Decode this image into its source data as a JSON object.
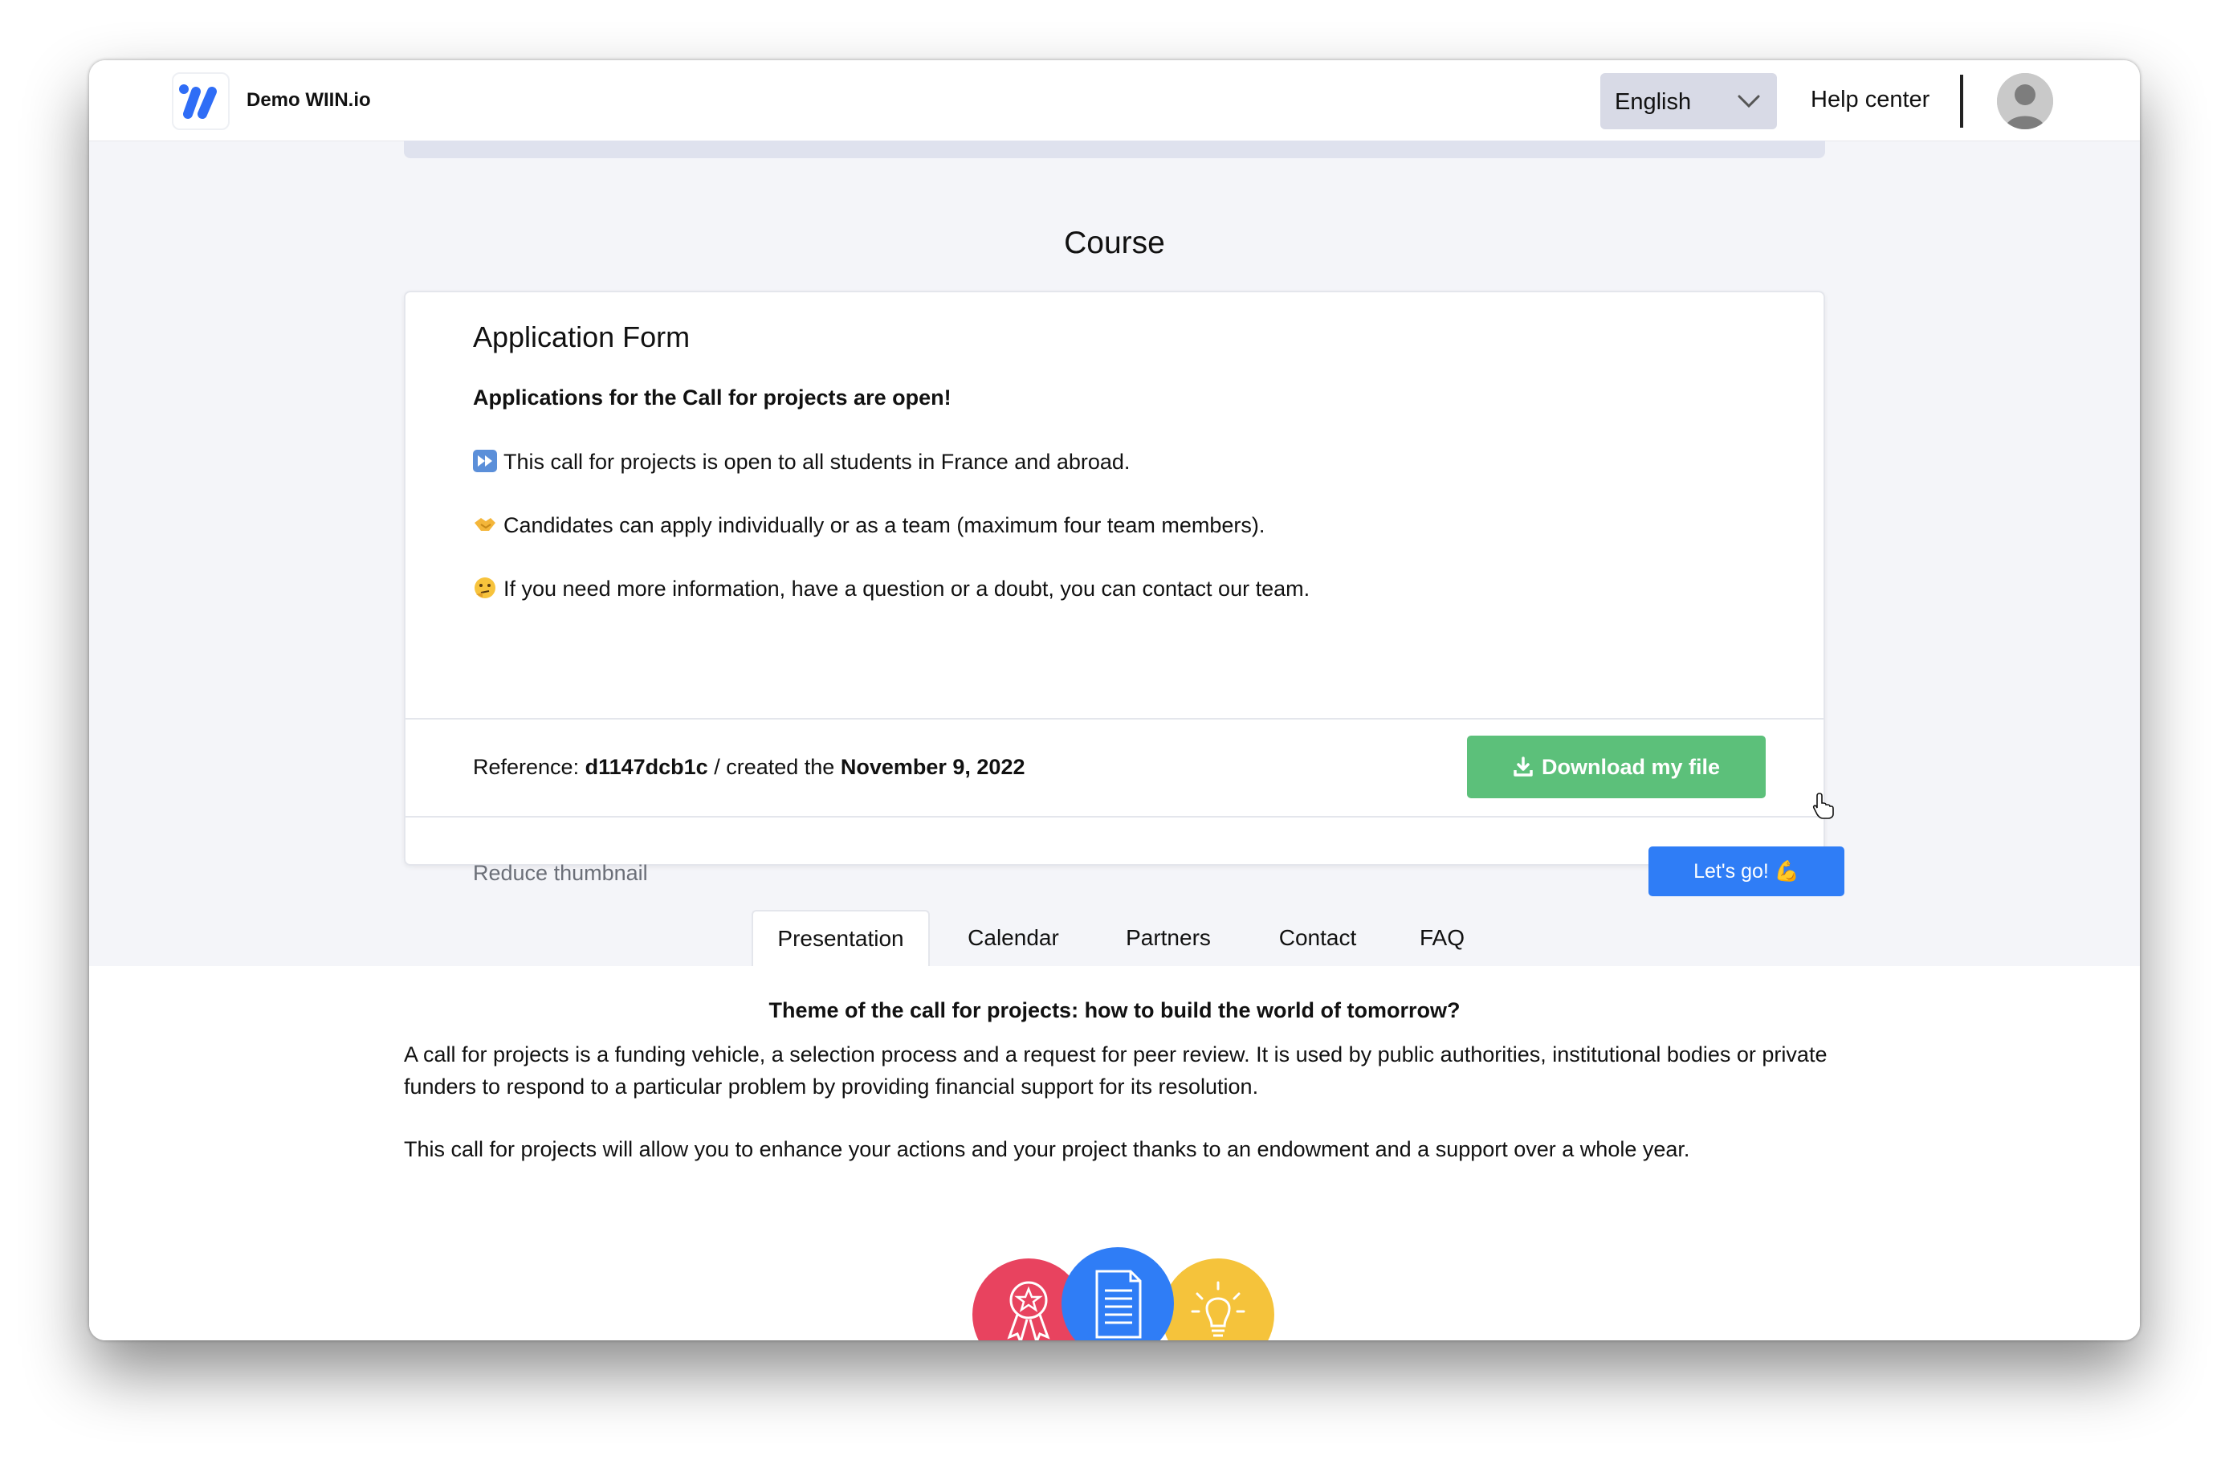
{
  "header": {
    "brand": "Demo WIIN.io",
    "language": "English",
    "help_link": "Help center"
  },
  "page": {
    "title": "Course"
  },
  "card": {
    "title": "Application Form",
    "subtitle": "Applications for the Call for projects are open!",
    "bullets": [
      {
        "icon": "fast-forward-icon",
        "text": "This call for projects is open to all students in France and abroad."
      },
      {
        "icon": "handshake-icon",
        "text": "Candidates can apply individually or as a team (maximum four team members)."
      },
      {
        "icon": "thinking-face-icon",
        "text": "If you need more information, have a question or a doubt, you can contact our team."
      }
    ],
    "reference": {
      "prefix": "Reference:",
      "code": "d1147dcb1c",
      "middle": "/ created the",
      "date": "November 9, 2022"
    },
    "download_label": "Download my file",
    "reduce_label": "Reduce thumbnail",
    "letsgo_label": "Let's go! 💪"
  },
  "tabs": [
    {
      "label": "Presentation",
      "active": true
    },
    {
      "label": "Calendar",
      "active": false
    },
    {
      "label": "Partners",
      "active": false
    },
    {
      "label": "Contact",
      "active": false
    },
    {
      "label": "FAQ",
      "active": false
    }
  ],
  "content": {
    "heading": "Theme of the call for projects: how to build the world of tomorrow?",
    "paragraph_1": "A call for projects is a funding vehicle, a selection process and a request for peer review. It is used by public authorities, institutional bodies or private funders to respond to a particular problem by providing financial support for its resolution.",
    "paragraph_2": "This call for projects will allow you to enhance your actions and your project thanks to an endowment and a support over a whole year."
  },
  "colors": {
    "download_green": "#5cc07a",
    "primary_blue": "#2f7df6",
    "circle_red": "#e8435f",
    "circle_blue": "#2f7df6",
    "circle_yellow": "#f5c33b"
  }
}
